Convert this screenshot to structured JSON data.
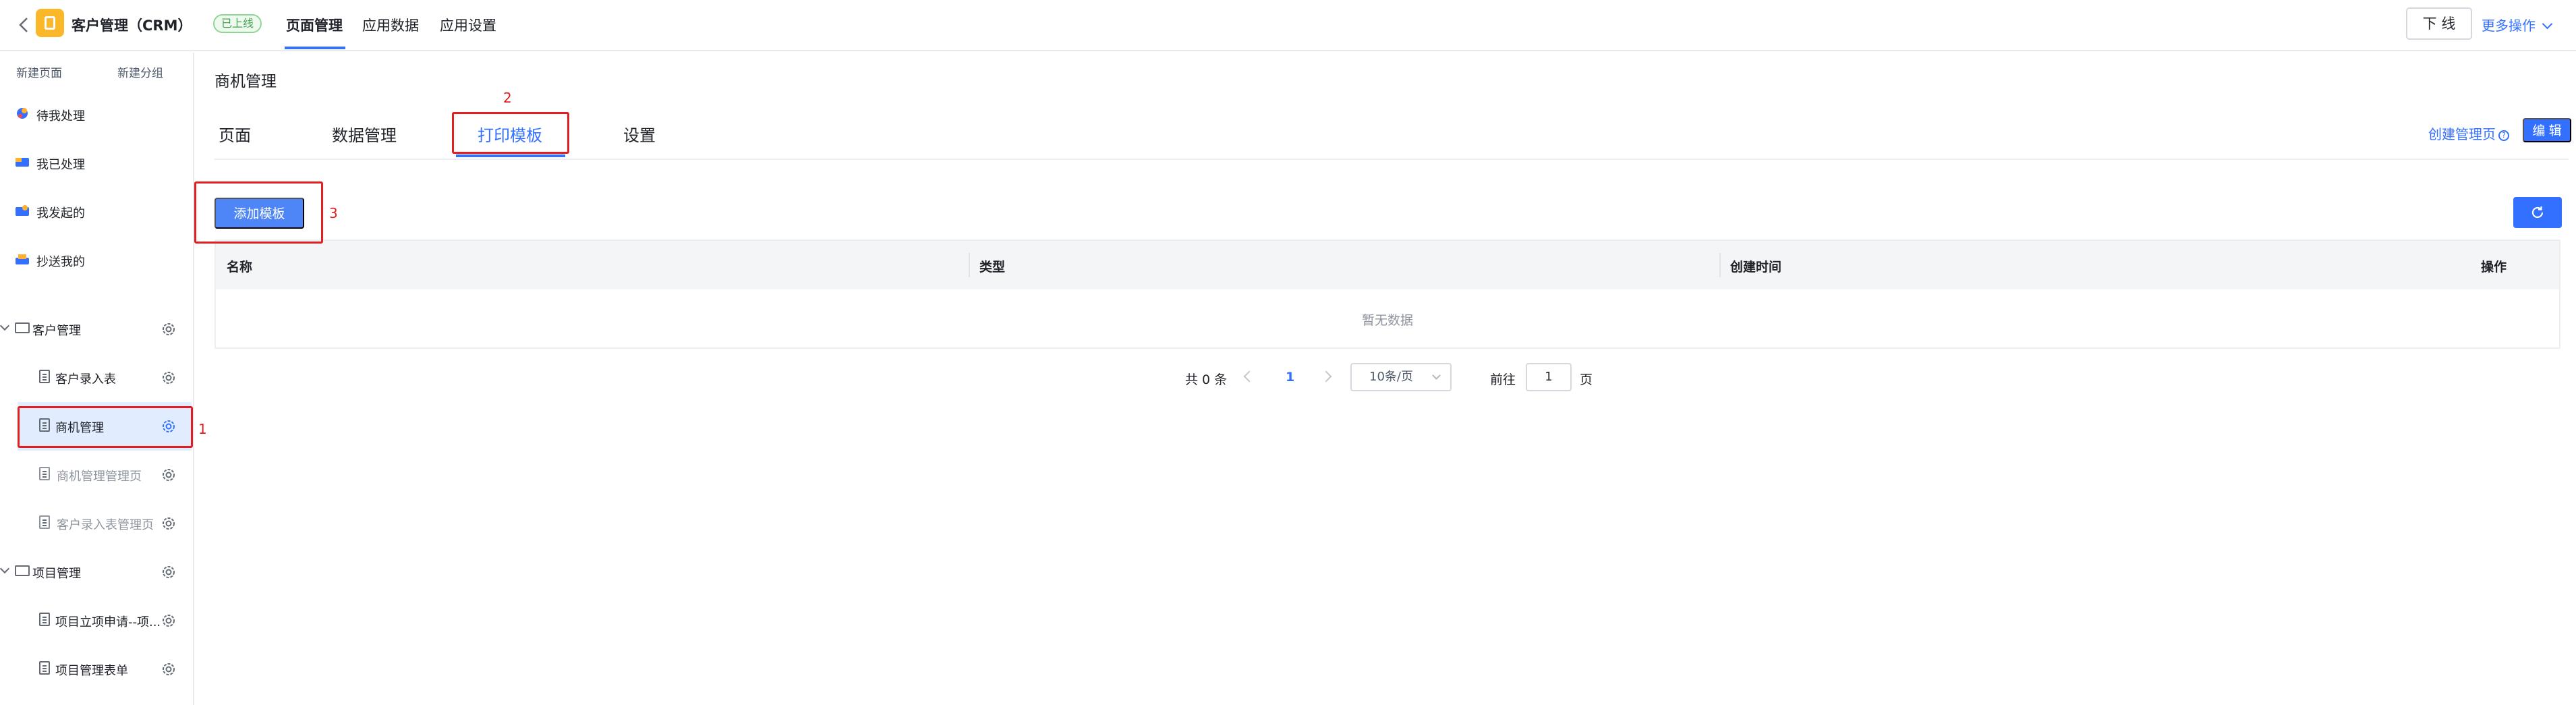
{
  "header": {
    "app_name": "客户管理（CRM）",
    "status_badge": "已上线",
    "nav": [
      "页面管理",
      "应用数据",
      "应用设置"
    ],
    "offline_button": "下 线",
    "more_ops": "更多操作"
  },
  "sidebar": {
    "new_page": "新建页面",
    "new_group": "新建分组",
    "items": [
      {
        "label": "待我处理"
      },
      {
        "label": "我已处理"
      },
      {
        "label": "我发起的"
      },
      {
        "label": "抄送我的"
      }
    ],
    "groups": [
      {
        "label": "客户管理",
        "children": [
          "客户录入表",
          "商机管理",
          "商机管理管理页",
          "客户录入表管理页"
        ]
      },
      {
        "label": "项目管理",
        "children": [
          "项目立项申请--项...",
          "项目管理表单"
        ]
      }
    ]
  },
  "main": {
    "page_title": "商机管理",
    "tabs": [
      "页面",
      "数据管理",
      "打印模板",
      "设置"
    ],
    "create_link": "创建管理页",
    "edit_button": "编 辑",
    "add_button": "添加模板",
    "table": {
      "headers": [
        "名称",
        "类型",
        "创建时间",
        "操作"
      ],
      "empty_text": "暂无数据"
    },
    "pager": {
      "total": "共 0 条",
      "current_page": "1",
      "page_size": "10条/页",
      "goto": "前往",
      "goto_value": "1",
      "page_unit": "页"
    }
  },
  "annotations": [
    "1",
    "2",
    "3"
  ],
  "colors": {
    "accent": "#3370ff",
    "annotation": "#e02020",
    "selected_bg": "#e1ecff"
  }
}
